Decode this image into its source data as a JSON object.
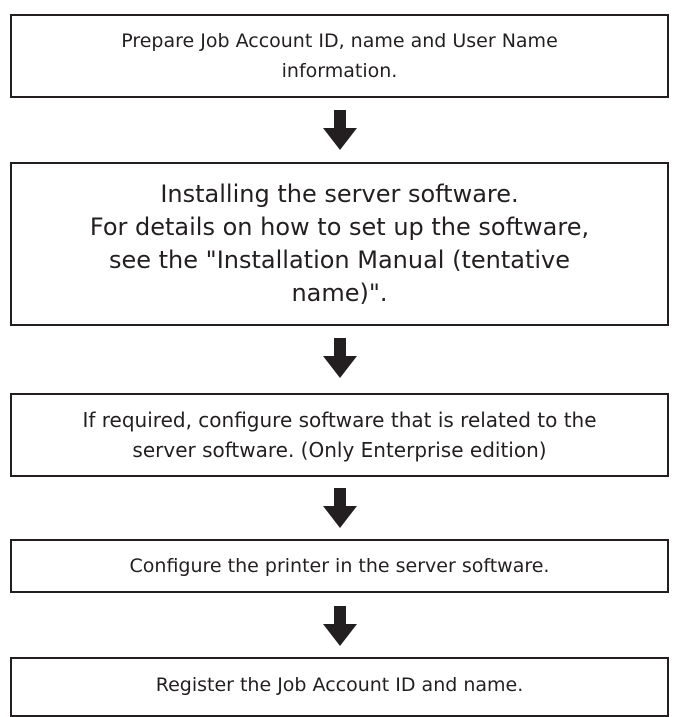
{
  "steps": [
    {
      "text": "Prepare Job Account ID, name and User Name\ninformation."
    },
    {
      "text": "Installing the server software.\nFor details on how to set up the software,\nsee the \"Installation Manual (tentative\nname)\"."
    },
    {
      "text": "If required, configure software that is related to the\nserver software. (Only Enterprise edition)"
    },
    {
      "text": "Configure the printer in the server software."
    },
    {
      "text": "Register the Job Account ID and name."
    }
  ],
  "colors": {
    "line": "#231f20",
    "background": "#ffffff"
  }
}
